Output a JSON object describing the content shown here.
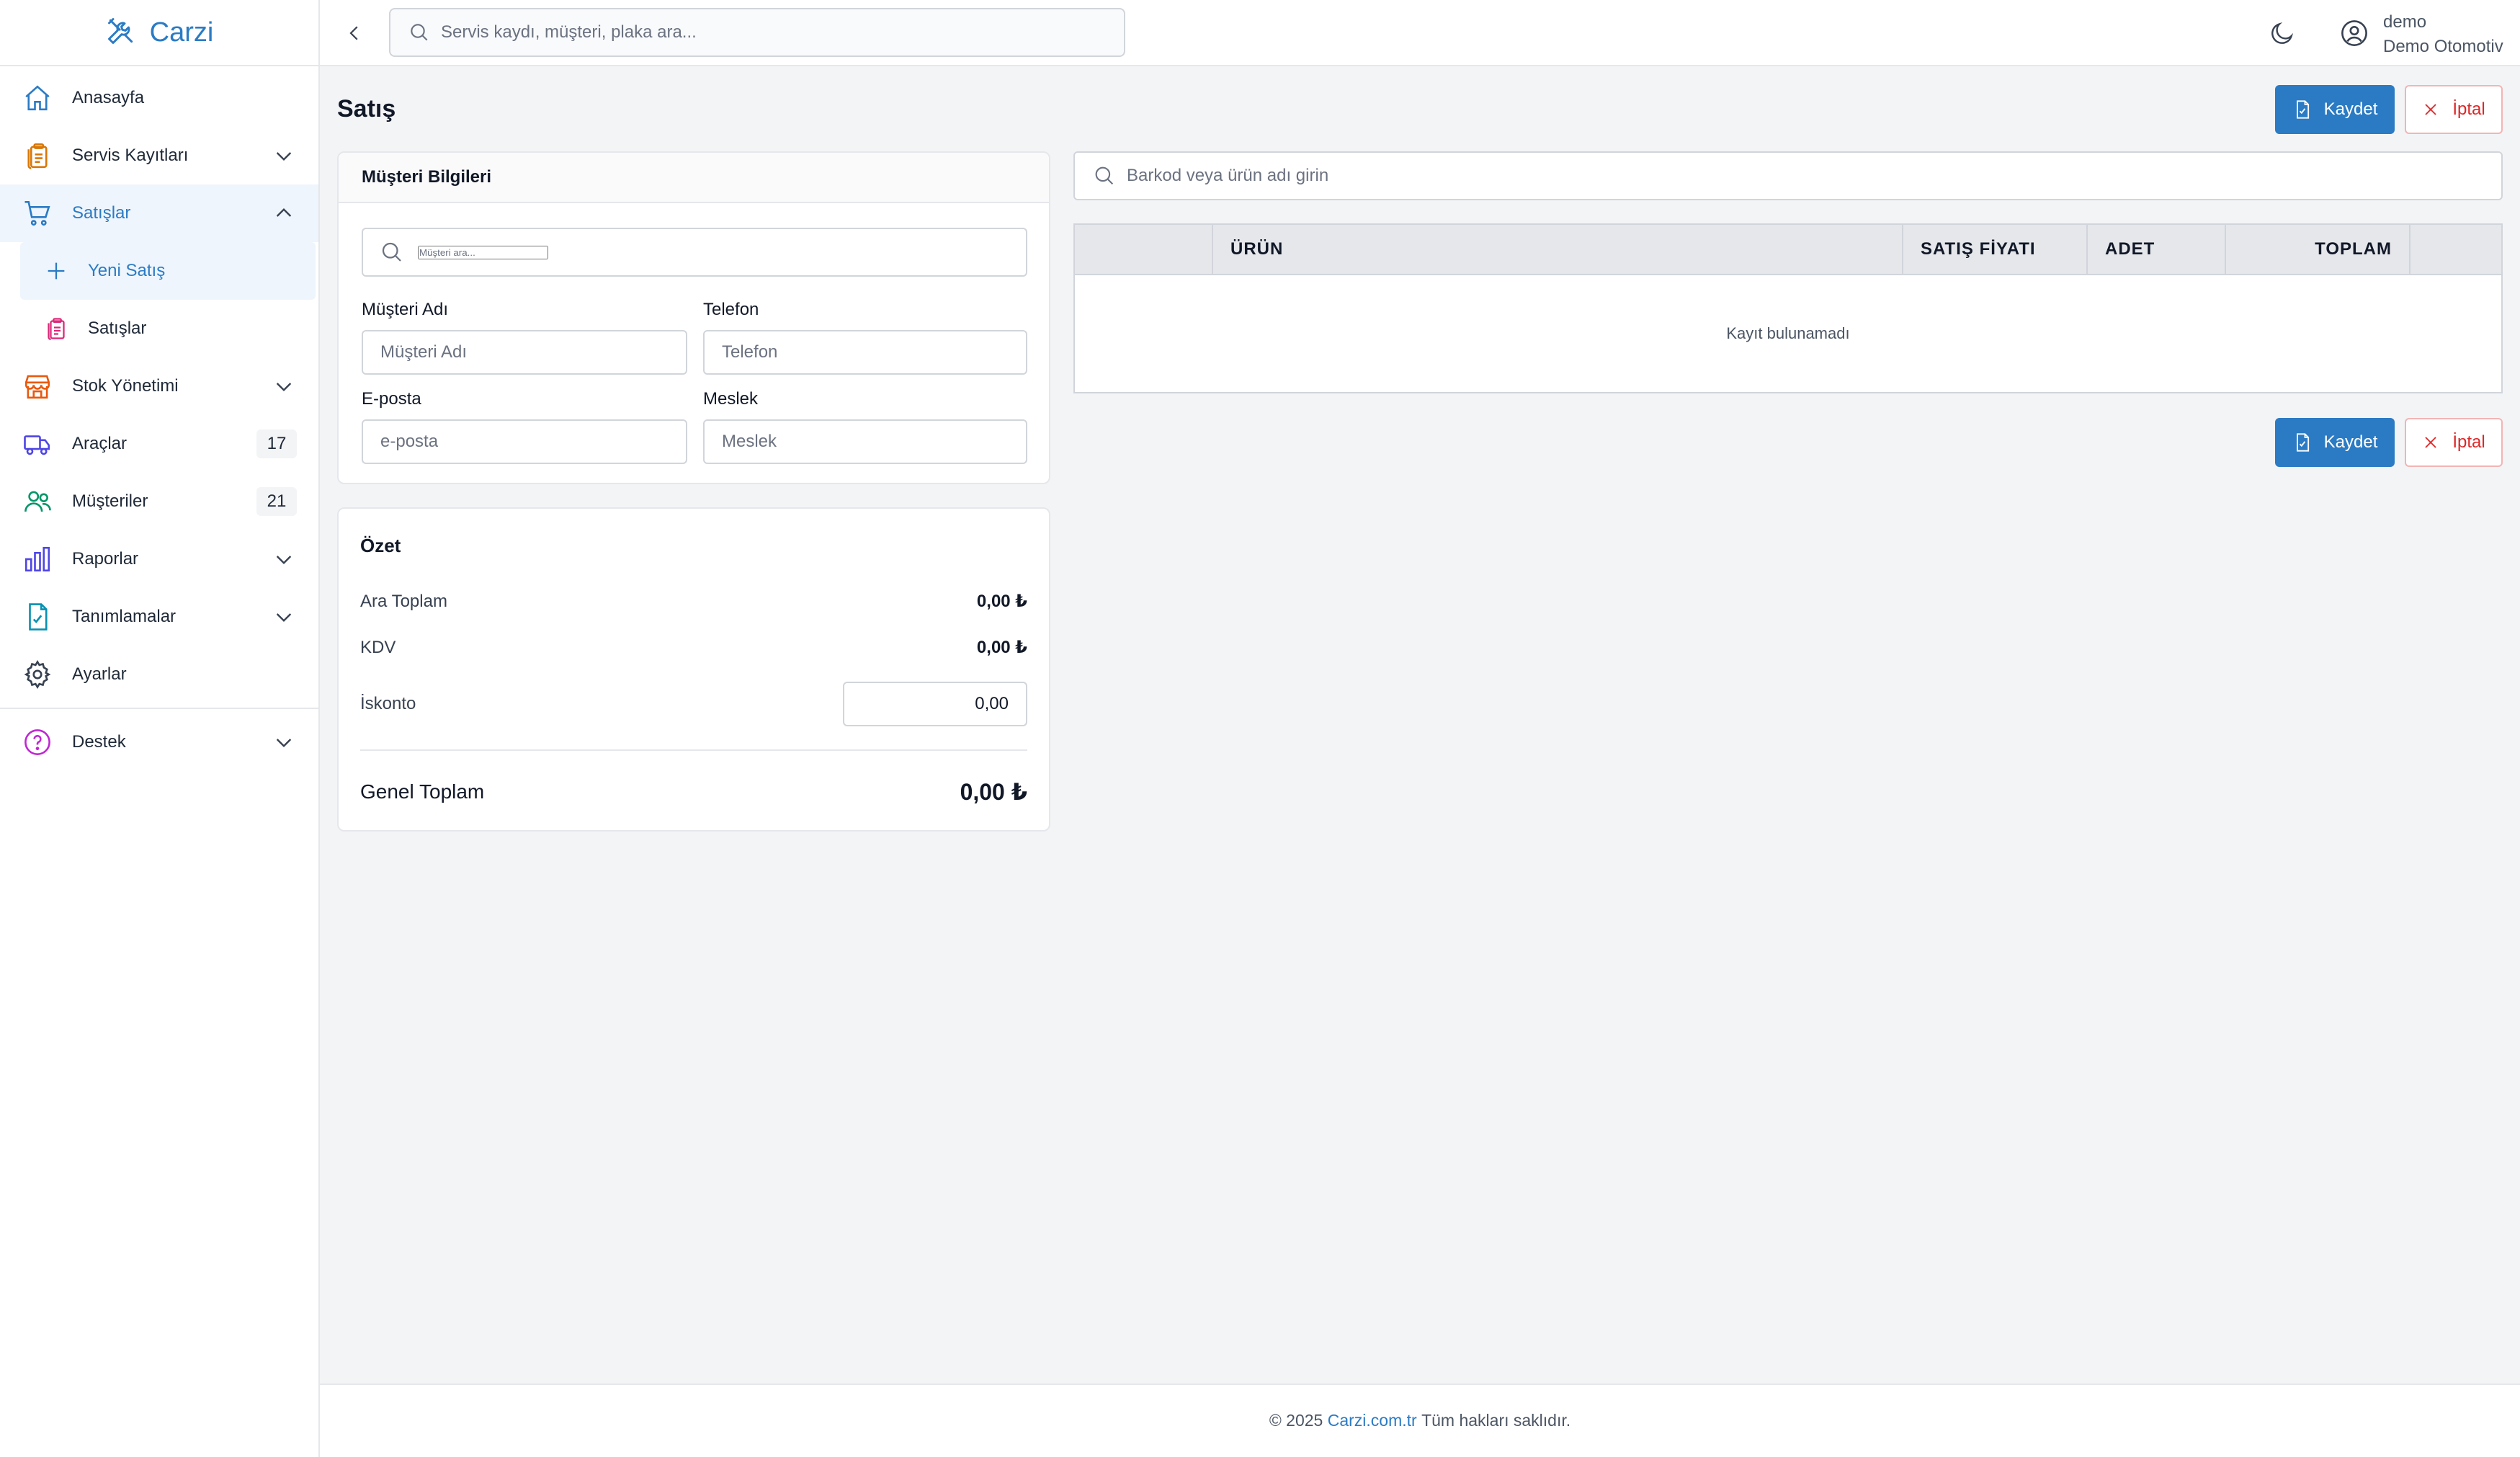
{
  "app": {
    "brand": "Carzi",
    "brand_color": "#2b7bc4"
  },
  "topbar": {
    "search_placeholder": "Servis kaydı, müşteri, plaka ara...",
    "user_name": "demo",
    "company": "Demo Otomotiv"
  },
  "sidebar": {
    "items": [
      {
        "label": "Anasayfa",
        "icon": "home-icon"
      },
      {
        "label": "Servis Kayıtları",
        "icon": "clipboard-icon"
      },
      {
        "label": "Satışlar",
        "icon": "cart-icon"
      },
      {
        "label": "Stok Yönetimi",
        "icon": "store-icon"
      },
      {
        "label": "Araçlar",
        "icon": "truck-icon",
        "badge": "17"
      },
      {
        "label": "Müşteriler",
        "icon": "users-icon",
        "badge": "21"
      },
      {
        "label": "Raporlar",
        "icon": "chart-icon"
      },
      {
        "label": "Tanımlamalar",
        "icon": "doc-check-icon"
      },
      {
        "label": "Ayarlar",
        "icon": "gear-icon"
      },
      {
        "label": "Destek",
        "icon": "help-icon"
      }
    ],
    "sub_items": [
      {
        "label": "Yeni Satış",
        "icon": "plus-icon"
      },
      {
        "label": "Satışlar",
        "icon": "clipboard-icon"
      }
    ]
  },
  "page": {
    "title": "Satış",
    "save_label": "Kaydet",
    "cancel_label": "İptal"
  },
  "customer": {
    "title": "Müşteri Bilgileri",
    "search_placeholder": "Müşteri ara...",
    "name_label": "Müşteri Adı",
    "name_placeholder": "Müşteri Adı",
    "phone_label": "Telefon",
    "phone_placeholder": "Telefon",
    "email_label": "E-posta",
    "email_placeholder": "e-posta",
    "job_label": "Meslek",
    "job_placeholder": "Meslek"
  },
  "summary": {
    "title": "Özet",
    "subtotal_label": "Ara Toplam",
    "subtotal_value": "0,00 ₺",
    "vat_label": "KDV",
    "vat_value": "0,00 ₺",
    "discount_label": "İskonto",
    "discount_value": "0,00",
    "grand_label": "Genel Toplam",
    "grand_value": "0,00 ₺"
  },
  "products": {
    "search_placeholder": "Barkod veya ürün adı girin",
    "columns": [
      "",
      "ÜRÜN",
      "SATIŞ FİYATI",
      "ADET",
      "TOPLAM",
      ""
    ],
    "empty_text": "Kayıt bulunamadı"
  },
  "footer": {
    "prefix": "© 2025",
    "link": "Carzi.com.tr",
    "suffix": "Tüm hakları saklıdır."
  }
}
